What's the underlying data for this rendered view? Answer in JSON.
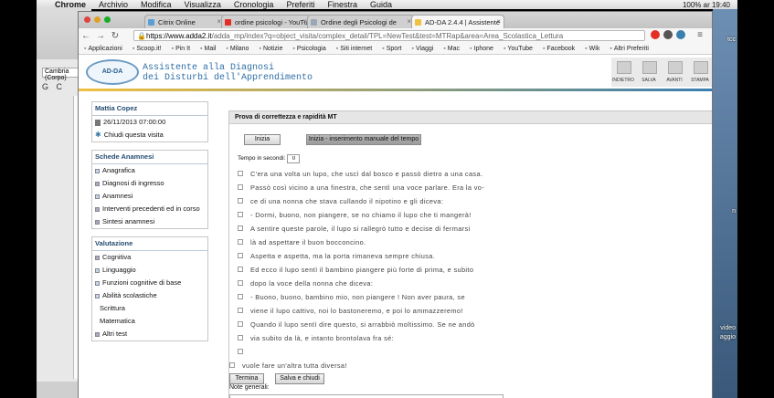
{
  "menubar": {
    "app": "Chrome",
    "items": [
      "Archivio",
      "Modifica",
      "Visualizza",
      "Cronologia",
      "Preferiti",
      "Finestra",
      "Guida"
    ],
    "clock": "100%  ar 19:40"
  },
  "background_app": {
    "font": "Cambria (Corpo)",
    "glyphs": "G C"
  },
  "desktop": {
    "labels": [
      "tcc",
      "n",
      "video",
      "aggio"
    ]
  },
  "browser": {
    "tabs": [
      "Citrix Online",
      "ordine psicologi - YouTub",
      "Ordine degli Psicologi de",
      "AD-DA 2.4.4 | Assistente"
    ],
    "close_glyph": "×",
    "nav": {
      "back": "←",
      "forward": "→",
      "reload": "↻"
    },
    "lock_glyph": "🔒",
    "menu_glyph": "≡",
    "url_host": "https://www.adda2.it",
    "url_rest": "/adda_mp/index?q=object_visita/complex_detail/TPL=NewTest&test=MTRap&area=Area_Scolastica_Lettura",
    "bookmarks": [
      "Applicazioni",
      "Scoop.it!",
      "Pin It",
      "Mail",
      "Milano",
      "Notizie",
      "Psicologia",
      "Siti internet",
      "Sport",
      "Viaggi",
      "Mac",
      "Iphone",
      "YouTube",
      "Facebook",
      "Wik",
      "Altri Preferiti"
    ]
  },
  "site": {
    "logo_text": "AD-DA",
    "title_line1": "Assistente alla Diagnosi",
    "title_line2": "dei Disturbi dell'Apprendimento",
    "header_buttons": [
      "INDIETRO",
      "SALVA",
      "AVANTI",
      "STAMPA"
    ]
  },
  "sidebar": {
    "star_glyph": "✱",
    "patient": {
      "name": "Mattia Copez",
      "datetime": "26/11/2013 07:00:00",
      "close_visit": "Chiudi questa visita"
    },
    "schede": {
      "header": "Schede Anamnesi",
      "items": [
        "Anagrafica",
        "Diagnosi di ingresso",
        "Anamnesi",
        "Interventi precedenti ed in corso",
        "Sintesi anamnesi"
      ]
    },
    "valutazione": {
      "header": "Valutazione",
      "items": [
        "Cognitiva",
        "Linguaggio",
        "Funzioni cognitive di base",
        "Abilità scolastiche",
        "Scrittura",
        "Matematica",
        "Altri test"
      ]
    }
  },
  "test": {
    "title": "Prova di correttezza e rapidità MT",
    "start_label": "Inizia",
    "start_manual_label": "Inizia - inserimento manuale del tempo",
    "time_label": "Tempo in secondi:",
    "time_value": "0",
    "lines": [
      "C'era una volta un lupo, che uscì dal bosco e passò dietro a una casa.",
      "Passò così vicino a una finestra, che sentì una voce parlare. Era la vo-",
      "ce di una nonna che stava cullando il nipotino e gli diceva:",
      "- Dormi, buono, non piangere, se no chiamo il lupo che ti mangerà!",
      "A sentire queste parole, il lupo si rallegrò tutto e decise di fermarsi",
      "là ad aspettare il buon bocconcino.",
      "Aspetta e aspetta, ma la porta rimaneva sempre chiusa.",
      "Ed ecco il lupo sentì il bambino piangere più forte di prima, e subito",
      "dopo la voce della nonna che diceva:",
      "- Buono, buono, bambino mio, non piangere ! Non aver paura, se",
      "viene il lupo cattivo, noi lo bastoneremo, e poi lo ammazzeremo!",
      "Quando il lupo sentì dire questo, si arrabbiò moltissimo. Se ne andò",
      "via subito da là, e intanto brontolava fra sé:",
      "",
      "vuole fare un'altra tutta diversa!"
    ],
    "end_label": "Termina",
    "save_close_label": "Salva e chiudi",
    "notes_label": "Note generali:"
  }
}
